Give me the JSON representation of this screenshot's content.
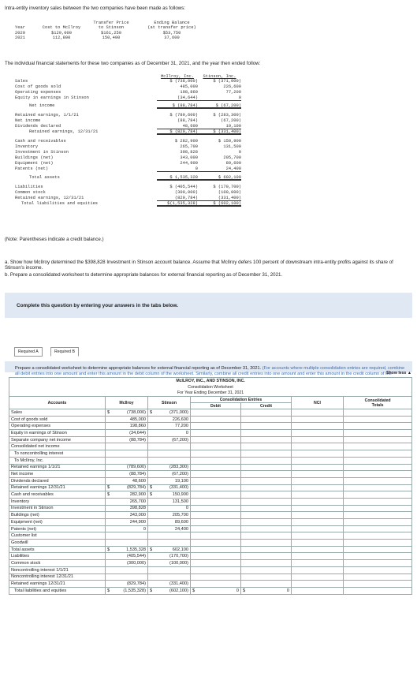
{
  "intro": "Intra-entity inventory sales between the two companies have been made as follows:",
  "transfer_table": {
    "headers": [
      "Year",
      "Cost to McIlroy",
      "Transfer Price\nto Stinson",
      "Ending Balance\n(at transfer price)"
    ],
    "h_year": "Year",
    "h_cost": "Cost to McIlroy",
    "h_tp1": "Transfer Price",
    "h_tp2": "to Stinson",
    "h_eb1": "Ending Balance",
    "h_eb2": "(at transfer price)",
    "rows": [
      {
        "year": "2020",
        "cost": "$129,000",
        "tp": "$161,250",
        "eb": "$53,750"
      },
      {
        "year": "2021",
        "cost": "112,800",
        "tp": "150,400",
        "eb": "37,600"
      }
    ]
  },
  "statements_intro": "The individual financial statements for these two companies as of December 31, 2021, and the year then ended follow:",
  "statements": {
    "h_mc1": "McIlroy, Inc.",
    "h_st1": "Stinson, Inc.",
    "rows": [
      {
        "label": "Sales",
        "m": "$ (738,000)",
        "s": "$ (371,000)"
      },
      {
        "label": "Cost of goods sold",
        "m": "485,000",
        "s": "226,600"
      },
      {
        "label": "Operating expenses",
        "m": "198,860",
        "s": "77,200"
      },
      {
        "label": "Equity in earnings in Stinson",
        "m": "(34,644)",
        "s": "0"
      },
      {
        "label": "Net income",
        "m": "$ (88,784)",
        "s": "$ (67,200)"
      },
      {
        "label": "Retained earnings, 1/1/21",
        "m": "$ (789,600)",
        "s": "$ (283,300)"
      },
      {
        "label": "Net income",
        "m": "(88,784)",
        "s": "(67,200)"
      },
      {
        "label": "Dividends declared",
        "m": "48,600",
        "s": "19,100"
      },
      {
        "label": "Retained earnings, 12/31/21",
        "m": "$ (829,784)",
        "s": "$ (331,400)"
      },
      {
        "label": "Cash and receivables",
        "m": "$ 282,900",
        "s": "$ 150,900"
      },
      {
        "label": "Inventory",
        "m": "265,700",
        "s": "131,500"
      },
      {
        "label": "Investment in Stinson",
        "m": "398,828",
        "s": "0"
      },
      {
        "label": "Buildings (net)",
        "m": "343,000",
        "s": "205,700"
      },
      {
        "label": "Equipment (net)",
        "m": "244,900",
        "s": "89,600"
      },
      {
        "label": "Patents (net)",
        "m": "0",
        "s": "24,400"
      },
      {
        "label": "Total assets",
        "m": "$ 1,535,328",
        "s": "$ 602,100"
      },
      {
        "label": "Liabilities",
        "m": "$ (405,544)",
        "s": "$ (170,700)"
      },
      {
        "label": "Common stock",
        "m": "(300,000)",
        "s": "(100,000)"
      },
      {
        "label": "Retained earnings, 12/31/21",
        "m": "(829,784)",
        "s": "(331,400)"
      },
      {
        "label": "Total liabilities and equities",
        "m": "$(1,535,328)",
        "s": "$ (602,100)"
      }
    ]
  },
  "note": "(Note: Parentheses indicate a credit balance.)",
  "question_a": "a. Show how McIlroy determined the $398,828 Investment in Stinson account balance. Assume that McIlroy defers 100 percent of downstream intra-entity profits against its share of Stinson's income.",
  "question_b": "b. Prepare a consolidated worksheet to determine appropriate balances for external financial reporting as of December 31, 2021.",
  "complete_banner": "Complete this question by entering your answers in the tabs below.",
  "tabs": {
    "a": "Required A",
    "b": "Required B"
  },
  "instructions_main": "Prepare a consolidated worksheet to determine appropriate balances for external financial reporting as of December 31, 2021.",
  "instructions_hint": " (For accounts where multiple consolidation entries are required, combine all debit entries into one amount and enter this amount in the debit column of the worksheet. Similarly, combine all credit entries into one amount and enter this amount in the credit column of the worksheet. Input all amounts as positive values.)",
  "show_less": "Show less ▲",
  "worksheet": {
    "company": "McILROY, INC., AND STINSON, INC.",
    "title": "Consolidation Worksheet",
    "period": "For Year Ending December 31, 2021",
    "cons_entries": "Consolidation Entries",
    "col_accounts": "Accounts",
    "col_mcilroy": "McIlroy",
    "col_stinson": "Stinson",
    "col_debit": "Debit",
    "col_credit": "Credit",
    "col_nci": "NCI",
    "col_cons1": "Consolidated",
    "col_cons2": "Totals",
    "rows": [
      {
        "label": "Sales",
        "ind": false,
        "md": "$",
        "m": "(738,000)",
        "sd": "$",
        "s": "(371,000)"
      },
      {
        "label": "Cost of goods sold",
        "ind": false,
        "md": "",
        "m": "485,000",
        "sd": "",
        "s": "226,600"
      },
      {
        "label": "Operating expenses",
        "ind": false,
        "md": "",
        "m": "198,860",
        "sd": "",
        "s": "77,200"
      },
      {
        "label": "Equity in earnings of Stinson",
        "ind": false,
        "md": "",
        "m": "(34,644)",
        "sd": "",
        "s": "0"
      },
      {
        "label": "Separate company net income",
        "ind": false,
        "md": "",
        "m": "(88,784)",
        "sd": "",
        "s": "(67,200)"
      },
      {
        "label": "Consolidated net income",
        "ind": false,
        "md": "",
        "m": "",
        "sd": "",
        "s": ""
      },
      {
        "label": "To noncontrolling interest",
        "ind": true,
        "md": "",
        "m": "",
        "sd": "",
        "s": ""
      },
      {
        "label": "To McIlroy, Inc.",
        "ind": true,
        "md": "",
        "m": "",
        "sd": "",
        "s": ""
      },
      {
        "label": "Retained earnings 1/1/21",
        "ind": false,
        "md": "",
        "m": "(789,600)",
        "sd": "",
        "s": "(283,300)"
      },
      {
        "label": "Net income",
        "ind": false,
        "md": "",
        "m": "(88,784)",
        "sd": "",
        "s": "(67,200)"
      },
      {
        "label": "Dividends declared",
        "ind": false,
        "md": "",
        "m": "48,600",
        "sd": "",
        "s": "19,100"
      },
      {
        "label": "Retained earnings 12/31/21",
        "ind": false,
        "md": "$",
        "m": "(829,784)",
        "sd": "$",
        "s": "(331,400)"
      },
      {
        "label": "Cash and receivables",
        "ind": false,
        "md": "$",
        "m": "282,900",
        "sd": "$",
        "s": "150,900"
      },
      {
        "label": "Inventory",
        "ind": false,
        "md": "",
        "m": "265,700",
        "sd": "",
        "s": "131,500"
      },
      {
        "label": "Investment in Stinson",
        "ind": false,
        "md": "",
        "m": "398,828",
        "sd": "",
        "s": "0"
      },
      {
        "label": "Buildings (net)",
        "ind": false,
        "md": "",
        "m": "343,000",
        "sd": "",
        "s": "205,700"
      },
      {
        "label": "Equipment (net)",
        "ind": false,
        "md": "",
        "m": "244,900",
        "sd": "",
        "s": "89,600"
      },
      {
        "label": "Patents (net)",
        "ind": false,
        "md": "",
        "m": "0",
        "sd": "",
        "s": "24,400"
      },
      {
        "label": "Customer list",
        "ind": false,
        "md": "",
        "m": "",
        "sd": "",
        "s": ""
      },
      {
        "label": "Goodwill",
        "ind": false,
        "md": "",
        "m": "",
        "sd": "",
        "s": ""
      },
      {
        "label": "Total assets",
        "ind": false,
        "md": "$",
        "m": "1,535,328",
        "sd": "$",
        "s": "602,100"
      },
      {
        "label": "Liabilities",
        "ind": false,
        "md": "",
        "m": "(405,544)",
        "sd": "",
        "s": "(170,700)"
      },
      {
        "label": "Common stock",
        "ind": false,
        "md": "",
        "m": "(300,000)",
        "sd": "",
        "s": "(100,000)"
      },
      {
        "label": "Noncontrolling interest 1/1/21",
        "ind": false,
        "md": "",
        "m": "",
        "sd": "",
        "s": ""
      },
      {
        "label": "Noncontrolling interest 12/31/21",
        "ind": false,
        "md": "",
        "m": "",
        "sd": "",
        "s": ""
      },
      {
        "label": "Retained earnings 12/31/21",
        "ind": false,
        "md": "",
        "m": "(829,784)",
        "sd": "",
        "s": "(331,400)"
      },
      {
        "label": "Total liabilities and equities",
        "ind": true,
        "md": "$",
        "m": "(1,535,328)",
        "sd": "$",
        "s": "(602,100)"
      }
    ],
    "total_debit_sym": "$",
    "total_debit": "0",
    "total_credit_sym": "$",
    "total_credit": "0"
  }
}
